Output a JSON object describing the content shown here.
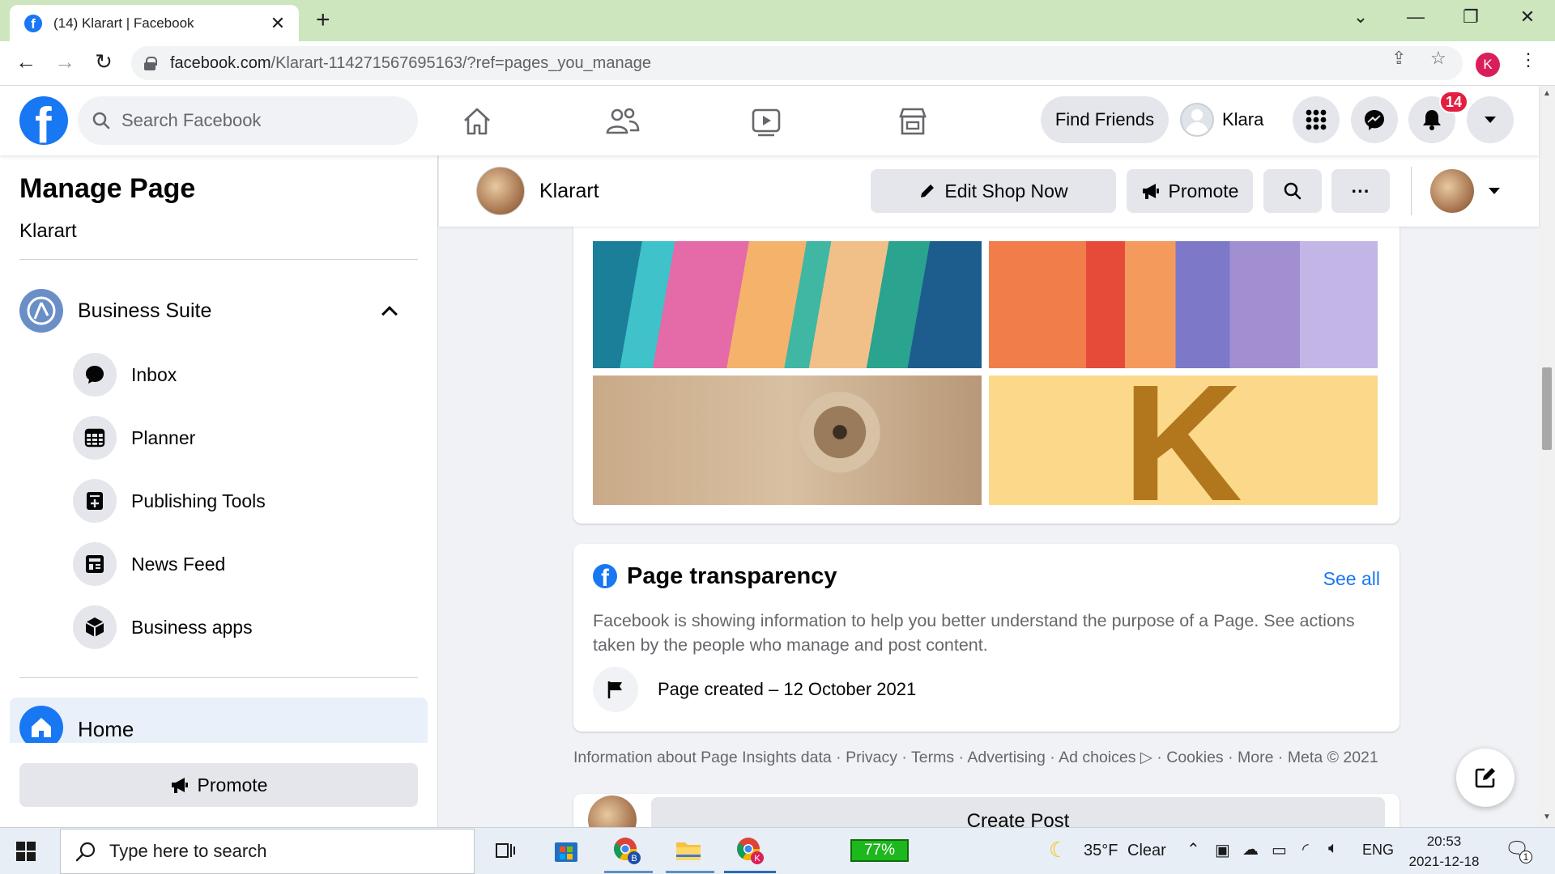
{
  "browser": {
    "tab_title": "(14) Klarart | Facebook",
    "tab_favicon_letter": "f",
    "url_host": "facebook.com",
    "url_path": "/Klarart-114271567695163/?ref=pages_you_manage",
    "profile_initial": "K",
    "profile_color": "#d91f5a"
  },
  "fb_header": {
    "logo_letter": "f",
    "search_placeholder": "Search Facebook",
    "find_friends_label": "Find Friends",
    "user_name": "Klara",
    "notification_count": "14",
    "brand_color": "#1877f2"
  },
  "sidebar": {
    "title": "Manage Page",
    "page_name": "Klarart",
    "business_suite_label": "Business Suite",
    "items": [
      {
        "label": "Inbox",
        "icon": "chat-bubble-icon"
      },
      {
        "label": "Planner",
        "icon": "calendar-grid-icon"
      },
      {
        "label": "Publishing Tools",
        "icon": "publishing-tools-icon"
      },
      {
        "label": "News Feed",
        "icon": "news-feed-icon"
      },
      {
        "label": "Business apps",
        "icon": "cube-icon"
      }
    ],
    "home_label": "Home",
    "promote_label": "Promote"
  },
  "page_bar": {
    "page_name": "Klarart",
    "edit_shop_label": "Edit Shop Now",
    "promote_label": "Promote",
    "more_label": "···"
  },
  "photos": {
    "k_letter": "K"
  },
  "transparency": {
    "title": "Page transparency",
    "see_all": "See all",
    "description": "Facebook is showing information to help you better understand the purpose of a Page. See actions taken by the people who manage and post content.",
    "page_created": "Page created – 12 October 2021"
  },
  "footer": {
    "links": [
      "Information about Page Insights data",
      "Privacy",
      "Terms",
      "Advertising",
      "Ad choices",
      "Cookies",
      "More",
      "Meta © 2021"
    ]
  },
  "create_post": {
    "label": "Create Post"
  },
  "taskbar": {
    "search_placeholder": "Type here to search",
    "battery_percent": "77%",
    "weather_temp": "35°F",
    "weather_desc": "Clear",
    "language": "ENG",
    "time": "20:53",
    "date": "2021-12-18",
    "notification_count": "1",
    "chrome_b_badge": "B",
    "chrome_k_badge": "K"
  }
}
